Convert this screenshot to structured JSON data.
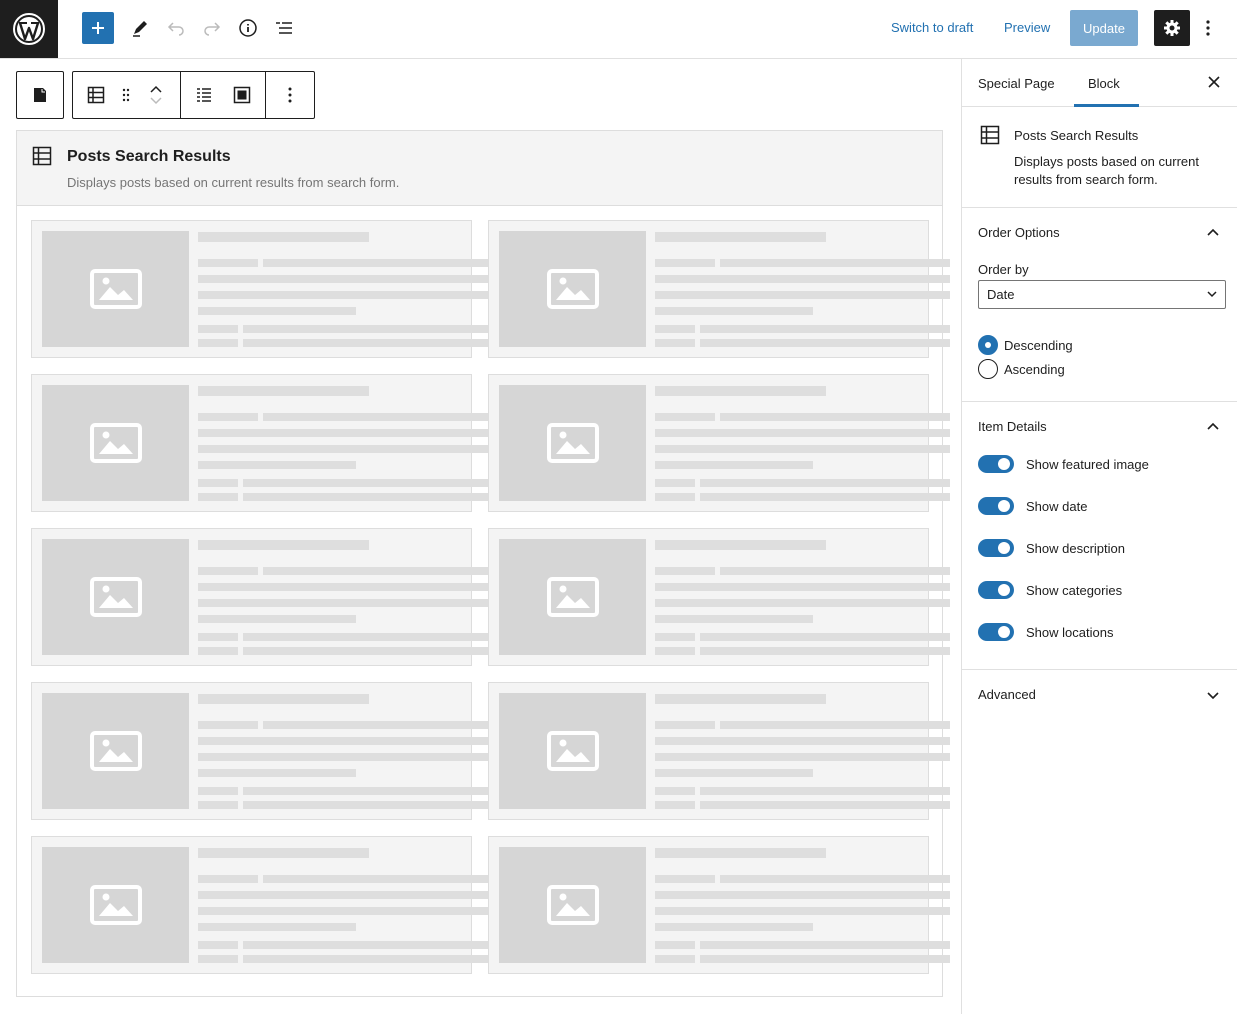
{
  "topbar": {
    "switch_to_draft": "Switch to draft",
    "preview": "Preview",
    "update": "Update"
  },
  "block": {
    "title": "Posts Search Results",
    "description": "Displays posts based on current results from search form.",
    "card_count": 10
  },
  "sidebar": {
    "tabs": [
      "Special Page",
      "Block"
    ],
    "active_tab": "Block",
    "card": {
      "title": "Posts Search Results",
      "description": "Displays posts based on current results from search form."
    },
    "order_options": {
      "title": "Order Options",
      "order_by_label": "Order by",
      "order_by_value": "Date",
      "radios": [
        {
          "label": "Descending",
          "checked": true
        },
        {
          "label": "Ascending",
          "checked": false
        }
      ]
    },
    "item_details": {
      "title": "Item Details",
      "toggles": [
        {
          "label": "Show featured image",
          "on": true
        },
        {
          "label": "Show date",
          "on": true
        },
        {
          "label": "Show description",
          "on": true
        },
        {
          "label": "Show categories",
          "on": true
        },
        {
          "label": "Show locations",
          "on": true
        }
      ]
    },
    "advanced": {
      "title": "Advanced"
    }
  },
  "colors": {
    "accent": "#2271b1",
    "dark": "#1e1e1e",
    "placeholder": "#d6d6d6"
  }
}
